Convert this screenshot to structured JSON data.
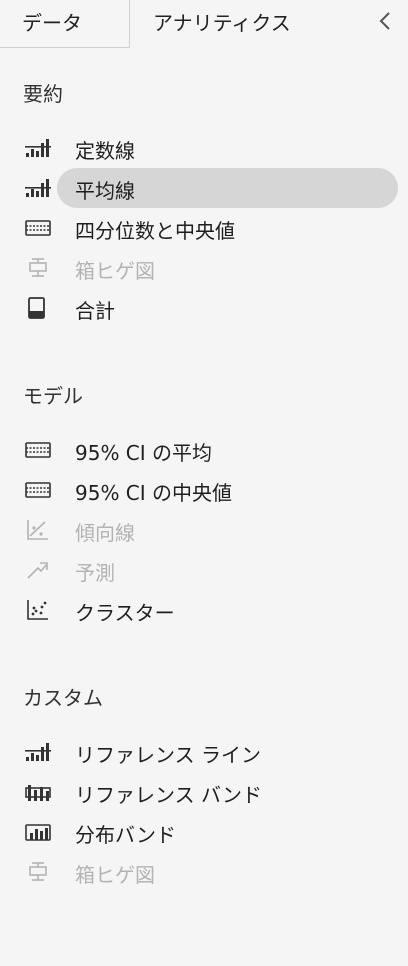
{
  "tabs": {
    "data_label": "データ",
    "analytics_label": "アナリティクス"
  },
  "colors": {
    "text": "#1f1f1f",
    "disabled": "#b3b3b3",
    "selected_bg": "#d6d6d6"
  },
  "sections": {
    "summary": {
      "title": "要約",
      "items": [
        {
          "label": "定数線",
          "icon": "constant-line-icon",
          "enabled": true
        },
        {
          "label": "平均線",
          "icon": "average-line-icon",
          "enabled": true,
          "selected": true
        },
        {
          "label": "四分位数と中央値",
          "icon": "quartile-icon",
          "enabled": true
        },
        {
          "label": "箱ヒゲ図",
          "icon": "box-plot-icon",
          "enabled": false
        },
        {
          "label": "合計",
          "icon": "totals-icon",
          "enabled": true
        }
      ]
    },
    "model": {
      "title": "モデル",
      "items": [
        {
          "label": "95% CI の平均",
          "icon": "ci-mean-icon",
          "enabled": true
        },
        {
          "label": "95% CI の中央値",
          "icon": "ci-median-icon",
          "enabled": true
        },
        {
          "label": "傾向線",
          "icon": "trend-line-icon",
          "enabled": false
        },
        {
          "label": "予測",
          "icon": "forecast-icon",
          "enabled": false
        },
        {
          "label": "クラスター",
          "icon": "cluster-icon",
          "enabled": true
        }
      ]
    },
    "custom": {
      "title": "カスタム",
      "items": [
        {
          "label": "リファレンス ライン",
          "icon": "reference-line-icon",
          "enabled": true
        },
        {
          "label": "リファレンス バンド",
          "icon": "reference-band-icon",
          "enabled": true
        },
        {
          "label": "分布バンド",
          "icon": "distribution-band-icon",
          "enabled": true
        },
        {
          "label": "箱ヒゲ図",
          "icon": "box-plot-icon",
          "enabled": false
        }
      ]
    }
  }
}
